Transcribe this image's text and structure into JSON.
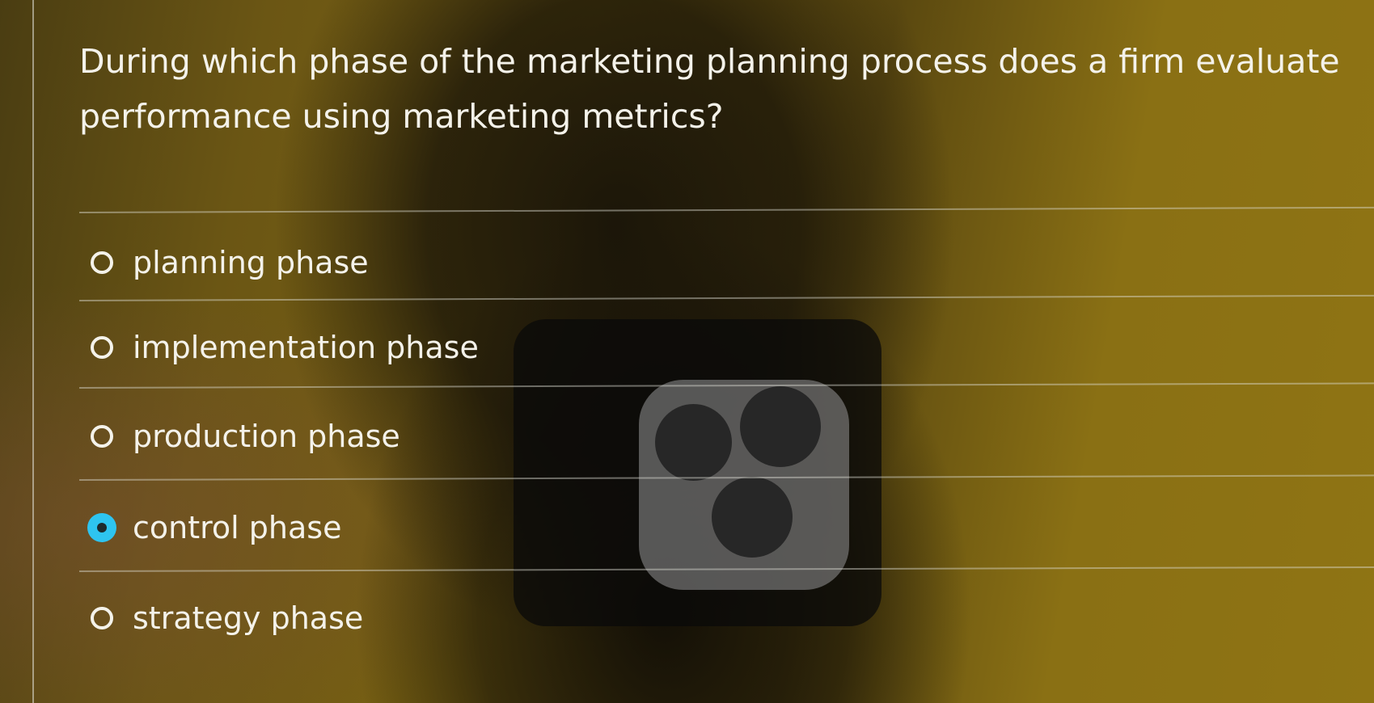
{
  "question": {
    "text": "During which phase of the marketing planning process does a firm evaluate performance using marketing metrics?"
  },
  "options": [
    {
      "label": "planning phase",
      "selected": false
    },
    {
      "label": "implementation phase",
      "selected": false
    },
    {
      "label": "production phase",
      "selected": false
    },
    {
      "label": "control phase",
      "selected": true
    },
    {
      "label": "strategy phase",
      "selected": false
    }
  ],
  "colors": {
    "selected_radio": "#2ec4f0",
    "text": "#f4f2ea"
  }
}
